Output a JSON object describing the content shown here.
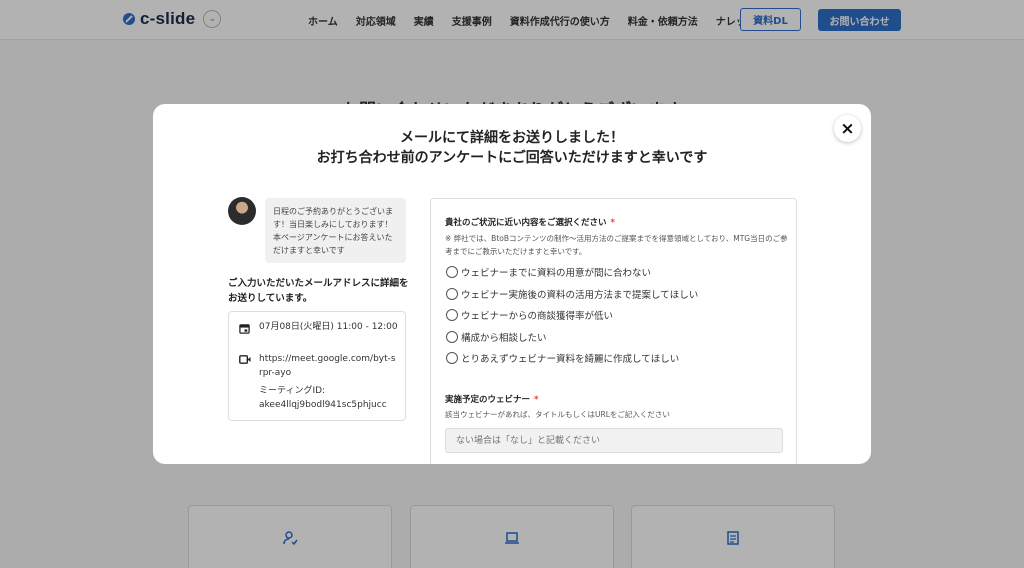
{
  "header": {
    "logo_text": "c-slide",
    "nav": [
      "ホーム",
      "対応領域",
      "実績",
      "支援事例",
      "資料作成代行の使い方",
      "料金・依頼方法",
      "ナレッジ"
    ],
    "download_label": "資料DL",
    "contact_label": "お問い合わせ",
    "accent_color": "#2f6fc9"
  },
  "background": {
    "title": "お問い合わせいただきありがとうございます"
  },
  "modal": {
    "title_line1": "メールにて詳細をお送りしました！",
    "title_line2": "お打ち合わせ前のアンケートにご回答いただけますと幸いです",
    "close_icon": "×",
    "bubble_text": "日程のご予約ありがとうございます！当日楽しみにしております！本ページアンケートにお答えいただけますと幸いです",
    "left_heading": "ご入力いただいたメールアドレスに詳細をお送りしています。",
    "meeting": {
      "datetime": "07月08日(火曜日) 11:00 - 12:00",
      "url": "https://meet.google.com/byt-srpr-ayo",
      "id_label": "ミーティングID:",
      "id_value": "akee4llqj9bodl941sc5phjucc"
    },
    "form": {
      "q1_label": "貴社のご状況に近い内容をご選択ください",
      "required_mark": "*",
      "q1_note": "※ 弊社では、BtoBコンテンツの制作〜活用方法のご提案までを得意領域としており、MTG当日のご参考までにご教示いただけますと幸いです。",
      "options": [
        "ウェビナーまでに資料の用意が間に合わない",
        "ウェビナー実施後の資料の活用方法まで提案してほしい",
        "ウェビナーからの商談獲得率が低い",
        "構成から相談したい",
        "とりあえずウェビナー資料を綺麗に作成してほしい"
      ],
      "q2_label": "実施予定のウェビナー",
      "q2_note": "該当ウェビナーがあれば、タイトルもしくはURLをご記入ください",
      "q2_placeholder": "ない場合は「なし」と記載ください"
    }
  }
}
